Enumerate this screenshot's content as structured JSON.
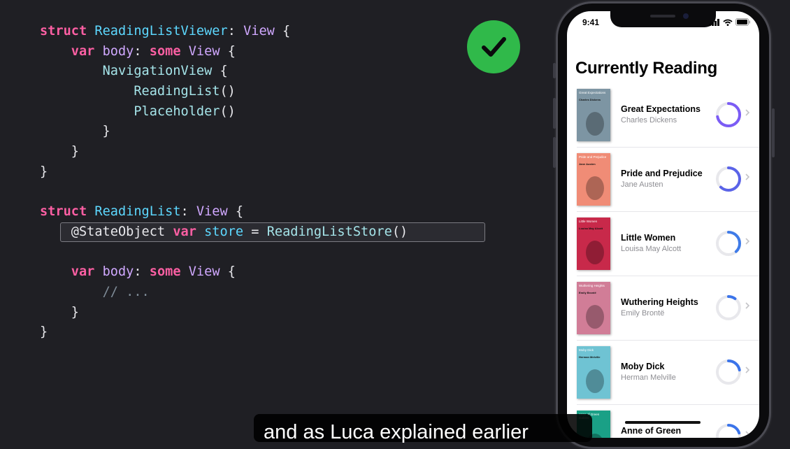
{
  "code": {
    "lines": [
      [
        [
          "kw",
          "struct"
        ],
        [
          "t",
          " "
        ],
        [
          "type",
          "ReadingListViewer"
        ],
        [
          "t",
          ": "
        ],
        [
          "sys",
          "View"
        ],
        [
          "t",
          " {"
        ]
      ],
      [
        [
          "t",
          "    "
        ],
        [
          "kw",
          "var"
        ],
        [
          "t",
          " "
        ],
        [
          "sys",
          "body"
        ],
        [
          "t",
          ": "
        ],
        [
          "kw",
          "some"
        ],
        [
          "t",
          " "
        ],
        [
          "sys",
          "View"
        ],
        [
          "t",
          " {"
        ]
      ],
      [
        [
          "t",
          "        "
        ],
        [
          "fn",
          "NavigationView"
        ],
        [
          "t",
          " {"
        ]
      ],
      [
        [
          "t",
          "            "
        ],
        [
          "fn",
          "ReadingList"
        ],
        [
          "t",
          "()"
        ]
      ],
      [
        [
          "t",
          "            "
        ],
        [
          "fn",
          "Placeholder"
        ],
        [
          "t",
          "()"
        ]
      ],
      [
        [
          "t",
          "        }"
        ]
      ],
      [
        [
          "t",
          "    }"
        ]
      ],
      [
        [
          "t",
          "}"
        ]
      ],
      [
        [
          "t",
          ""
        ]
      ],
      [
        [
          "kw",
          "struct"
        ],
        [
          "t",
          " "
        ],
        [
          "type",
          "ReadingList"
        ],
        [
          "t",
          ": "
        ],
        [
          "sys",
          "View"
        ],
        [
          "t",
          " {"
        ]
      ],
      [
        [
          "t",
          "    @StateObject "
        ],
        [
          "kw",
          "var"
        ],
        [
          "t",
          " "
        ],
        [
          "type",
          "store"
        ],
        [
          "t",
          " = "
        ],
        [
          "fn",
          "ReadingListStore"
        ],
        [
          "t",
          "()"
        ]
      ],
      [
        [
          "t",
          ""
        ]
      ],
      [
        [
          "t",
          "    "
        ],
        [
          "kw",
          "var"
        ],
        [
          "t",
          " "
        ],
        [
          "sys",
          "body"
        ],
        [
          "t",
          ": "
        ],
        [
          "kw",
          "some"
        ],
        [
          "t",
          " "
        ],
        [
          "sys",
          "View"
        ],
        [
          "t",
          " {"
        ]
      ],
      [
        [
          "t",
          "        "
        ],
        [
          "cmt",
          "// ..."
        ]
      ],
      [
        [
          "t",
          "    }"
        ]
      ],
      [
        [
          "t",
          "}"
        ]
      ]
    ]
  },
  "check_icon": "checkmark-circle-icon",
  "phone": {
    "status_time": "9:41",
    "nav_title": "Currently Reading",
    "books": [
      {
        "title": "Great Expectations",
        "author": "Charles Dickens",
        "cover_title": "Great Expectations",
        "cover_author": "Charles Dickens",
        "cover_color": "#7d95a3",
        "progress": 0.72,
        "ring_color": "#7b5cf5"
      },
      {
        "title": "Pride and Prejudice",
        "author": "Jane Austen",
        "cover_title": "Pride and Prejudice",
        "cover_author": "Jane Austen",
        "cover_color": "#f08c76",
        "progress": 0.62,
        "ring_color": "#5a63e8"
      },
      {
        "title": "Little Women",
        "author": "Louisa May Alcott",
        "cover_title": "Little Women",
        "cover_author": "Louisa May Alcott",
        "cover_color": "#c8294a",
        "progress": 0.38,
        "ring_color": "#3f7be8"
      },
      {
        "title": "Wuthering Heights",
        "author": "Emily Brontë",
        "cover_title": "Wuthering Heights",
        "cover_author": "Emily Brontë",
        "cover_color": "#d17d97",
        "progress": 0.1,
        "ring_color": "#3b74ea"
      },
      {
        "title": "Moby Dick",
        "author": "Herman Melville",
        "cover_title": "Moby Dick",
        "cover_author": "Herman Melville",
        "cover_color": "#6fc3d3",
        "progress": 0.22,
        "ring_color": "#3b74ea"
      },
      {
        "title": "Anne of Green",
        "author": "",
        "cover_title": "Anne of Green Gables",
        "cover_author": "",
        "cover_color": "#1aa086",
        "progress": 0.2,
        "ring_color": "#3b74ea"
      }
    ]
  },
  "caption": "and as Luca explained earlier"
}
